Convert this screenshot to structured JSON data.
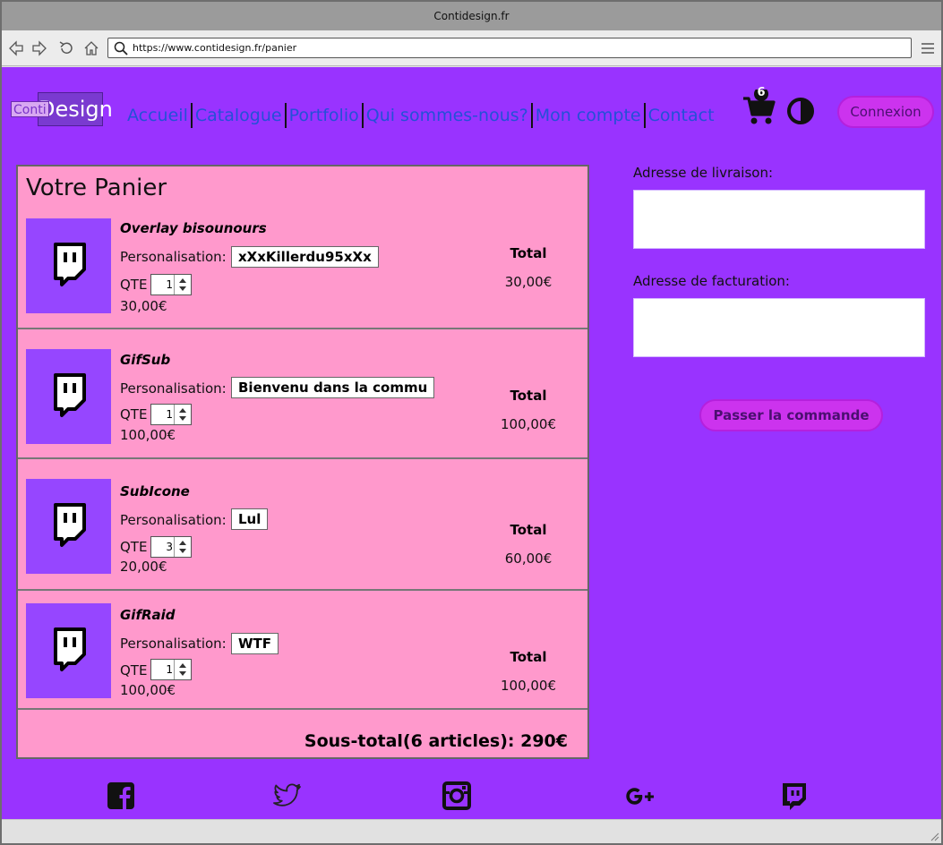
{
  "browser": {
    "title": "Contidesign.fr",
    "url": "https://www.contidesign.fr/panier"
  },
  "header": {
    "logo_left": "Conti",
    "logo_right": "Design",
    "nav": [
      "Accueil",
      "Catalogue",
      "Portfolio",
      "Qui sommes-nous?",
      "Mon compte",
      "Contact"
    ],
    "cart_count": "6",
    "login_label": "Connexion"
  },
  "cart": {
    "title": "Votre Panier",
    "customization_label": "Personalisation:",
    "qty_label": "QTE",
    "total_label": "Total",
    "items": [
      {
        "name": "Overlay bisounours",
        "customization": "xXxKillerdu95xXx",
        "qty": "1",
        "unit_price": "30,00€",
        "total": "30,00€"
      },
      {
        "name": "GifSub",
        "customization": "Bienvenu dans la commu",
        "qty": "1",
        "unit_price": "100,00€",
        "total": "100,00€"
      },
      {
        "name": "SubIcone",
        "customization": "Lul",
        "qty": "3",
        "unit_price": "20,00€",
        "total": "60,00€"
      },
      {
        "name": "GifRaid",
        "customization": "WTF",
        "qty": "1",
        "unit_price": "100,00€",
        "total": "100,00€"
      }
    ],
    "subtotal": "Sous-total(6 articles): 290€"
  },
  "checkout": {
    "shipping_label": "Adresse de livraison:",
    "shipping_value": "",
    "billing_label": "Adresse de facturation:",
    "billing_value": "",
    "order_button": "Passer la commande"
  },
  "footer": {
    "icons": [
      "facebook-icon",
      "twitter-icon",
      "instagram-icon",
      "google-plus-icon",
      "twitch-icon"
    ]
  },
  "colors": {
    "page_background": "#9933ff",
    "cart_background": "#ff99cc",
    "accent_button": "#cc33ee",
    "nav_link": "#2450d8",
    "product_tile": "#9646ff"
  }
}
